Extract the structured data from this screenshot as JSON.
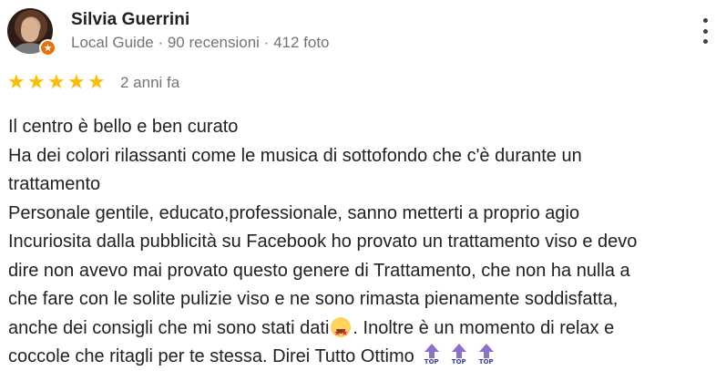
{
  "review": {
    "author": {
      "name": "Silvia Guerrini",
      "meta": "Local Guide · 90 recensioni · 412 foto",
      "badge_icon": "local-guide-star"
    },
    "rating": {
      "stars": 5,
      "max": 5,
      "star_glyph": "★",
      "date": "2 anni fa"
    },
    "lines": [
      "Il centro è bello e ben curato",
      "Ha dei colori rilassanti come le musica di sottofondo che c'è durante un",
      "trattamento",
      "Personale gentile, educato,professionale, sanno metterti a proprio agio",
      "Incuriosita dalla pubblicità su Facebook ho provato un trattamento viso e devo",
      "dire non avevo mai provato questo genere di Trattamento, che non ha nulla a",
      "che fare con le solite pulizie viso e ne sono rimasta pienamente soddisfatta,"
    ],
    "line_with_emoji": {
      "before": "anche dei consigli che mi sono stati dati",
      "emoji": "star-struck",
      "after": ". Inoltre è un momento di relax e"
    },
    "last_line": {
      "text": "coccole che ritagli per te stessa. Direi Tutto Ottimo",
      "top_icon_label": "TOP",
      "top_icon_count": 3
    }
  },
  "colors": {
    "star": "#fbbc04",
    "meta_text": "#70757a",
    "badge": "#e8710a",
    "top_icon": "#8e6fc9"
  },
  "icons": {
    "more": "more-vert-icon",
    "emoji": "star-struck-emoji-icon",
    "top": "top-arrow-icon"
  }
}
